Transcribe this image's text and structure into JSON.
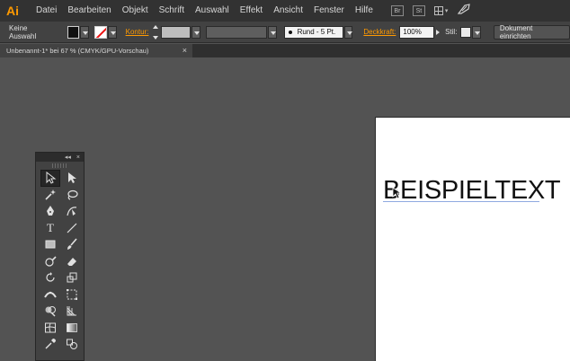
{
  "app": {
    "logo": "Ai"
  },
  "menu": {
    "items": [
      "Datei",
      "Bearbeiten",
      "Objekt",
      "Schrift",
      "Auswahl",
      "Effekt",
      "Ansicht",
      "Fenster",
      "Hilfe"
    ],
    "icons": [
      {
        "name": "bridge-icon",
        "glyph": "Br"
      },
      {
        "name": "stock-icon",
        "glyph": "St"
      }
    ]
  },
  "control_bar": {
    "selection_label": "Keine Auswahl",
    "stroke_label": "Kontur:",
    "brush_value": "Rund - 5 Pt.",
    "opacity_label": "Deckkraft:",
    "opacity_value": "100%",
    "style_label": "Stil:",
    "doc_setup_button": "Dokument einrichten"
  },
  "tab": {
    "title": "Unbenannt-1* bei 67 % (CMYK/GPU-Vorschau)",
    "close": "×"
  },
  "tools_panel": {
    "collapse": "◂◂",
    "close": "×",
    "tools": [
      "selection-tool-icon",
      "direct-selection-tool-icon",
      "magic-wand-tool-icon",
      "lasso-tool-icon",
      "pen-tool-icon",
      "curvature-tool-icon",
      "type-tool-icon",
      "line-segment-tool-icon",
      "rectangle-tool-icon",
      "paintbrush-tool-icon",
      "shaper-tool-icon",
      "eraser-tool-icon",
      "rotate-tool-icon",
      "scale-tool-icon",
      "width-tool-icon",
      "free-transform-tool-icon",
      "shape-builder-tool-icon",
      "perspective-grid-tool-icon",
      "mesh-tool-icon",
      "gradient-tool-icon",
      "eyedropper-tool-icon",
      "blend-tool-icon"
    ],
    "type_glyph": "T"
  },
  "artboard": {
    "text": "BEISPIELTEXT"
  },
  "colors": {
    "accent": "#ff9a00",
    "menubar_bg": "#323232",
    "panel_bg": "#424242",
    "workspace_bg": "#535353"
  }
}
